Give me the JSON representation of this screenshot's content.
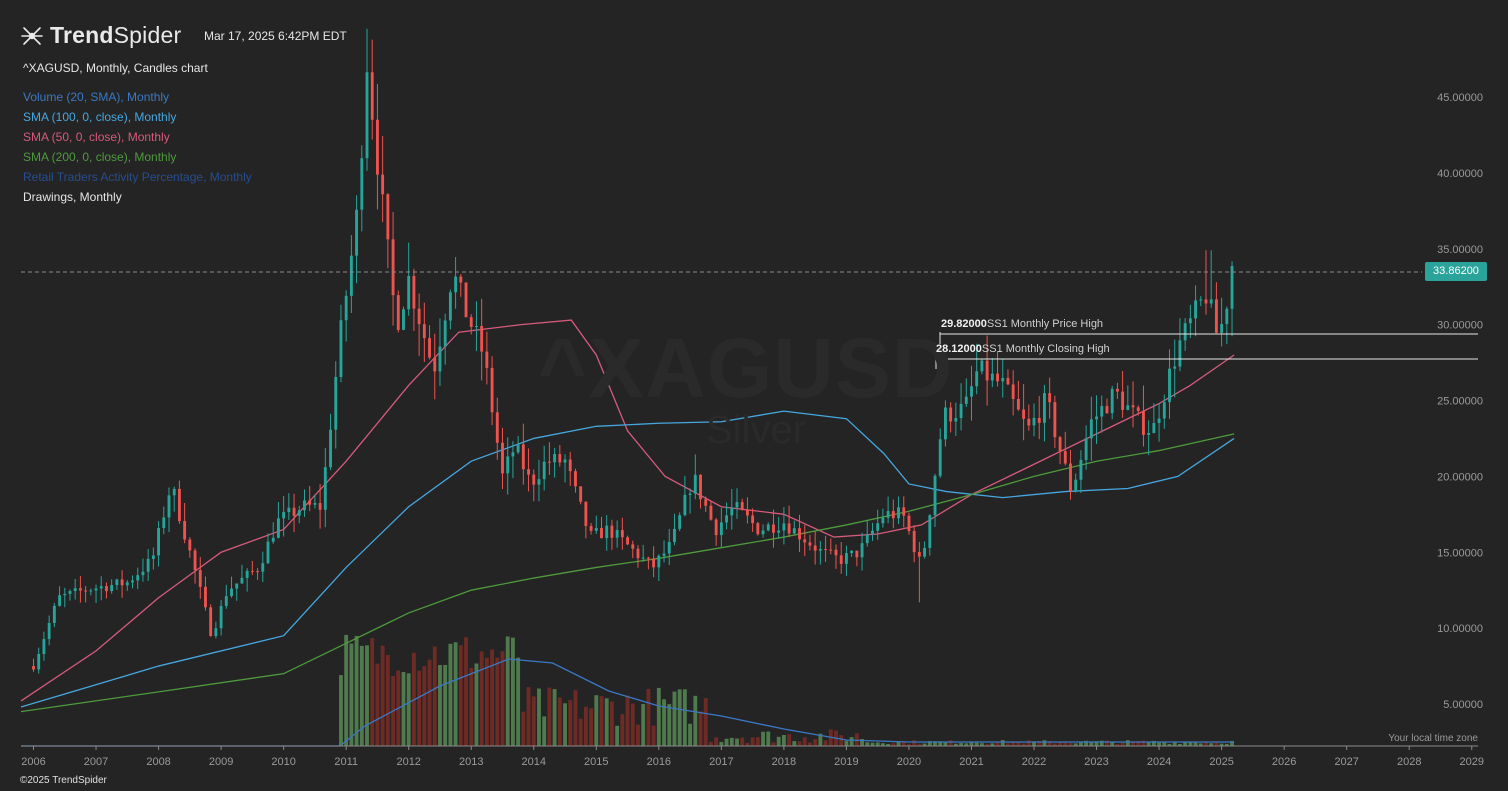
{
  "header": {
    "brand_bold": "Trend",
    "brand_light": "Spider",
    "timestamp": "Mar 17, 2025 6:42PM EDT",
    "symbol_title": "^XAGUSD, Monthly, Candles chart"
  },
  "legend": [
    {
      "label": "Volume (20, SMA), Monthly",
      "color": "#3b78c4"
    },
    {
      "label": "SMA (100, 0, close), Monthly",
      "color": "#46a6de"
    },
    {
      "label": "SMA (50, 0, close), Monthly",
      "color": "#d65a7c"
    },
    {
      "label": "SMA (200, 0, close), Monthly",
      "color": "#4e9a3c"
    },
    {
      "label": "Retail Traders Activity Percentage, Monthly",
      "color": "#274d8f"
    },
    {
      "label": "Drawings, Monthly",
      "color": "#e6e6e6"
    }
  ],
  "watermark": {
    "symbol": "^XAGUSD",
    "name": "Silver"
  },
  "current_price": "33.86200",
  "levels": [
    {
      "value": "29.82000",
      "label": "SS1 Monthly Price High"
    },
    {
      "value": "28.12000",
      "label": "SS1 Monthly Closing High"
    }
  ],
  "footer": {
    "copyright": "©2025 TrendSpider",
    "timezone_note": "Your local time zone"
  },
  "colors": {
    "up": "#26a69a",
    "down": "#ef5350",
    "vol_up": "#4f7a4d",
    "vol_down": "#6e2a25",
    "background": "#242424"
  },
  "chart_data": {
    "type": "candlestick",
    "interval": "Monthly",
    "x_range": [
      2005.8,
      2029.1
    ],
    "y_range": [
      2,
      49
    ],
    "x_ticks": [
      "2006",
      "2007",
      "2008",
      "2009",
      "2010",
      "2011",
      "2012",
      "2013",
      "2014",
      "2015",
      "2016",
      "2017",
      "2018",
      "2019",
      "2020",
      "2021",
      "2022",
      "2023",
      "2024",
      "2025",
      "2026",
      "2027",
      "2028",
      "2029"
    ],
    "y_ticks": [
      "5.00000",
      "10.00000",
      "15.00000",
      "20.00000",
      "25.00000",
      "30.00000",
      "35.00000",
      "40.00000",
      "45.00000"
    ],
    "last_close": 33.862,
    "horizontal_levels": [
      29.82,
      28.12
    ],
    "anchors": [
      {
        "t": 2006.0,
        "c": 7.5
      },
      {
        "t": 2006.4,
        "c": 12.0
      },
      {
        "t": 2006.9,
        "c": 12.6
      },
      {
        "t": 2007.5,
        "c": 13.0
      },
      {
        "t": 2007.9,
        "c": 14.5
      },
      {
        "t": 2008.2,
        "c": 19.5
      },
      {
        "t": 2008.6,
        "c": 13.5
      },
      {
        "t": 2008.85,
        "c": 9.5
      },
      {
        "t": 2009.1,
        "c": 12.5
      },
      {
        "t": 2009.6,
        "c": 14.0
      },
      {
        "t": 2009.9,
        "c": 17.0
      },
      {
        "t": 2010.3,
        "c": 18.0
      },
      {
        "t": 2010.6,
        "c": 18.0
      },
      {
        "t": 2010.9,
        "c": 29.0
      },
      {
        "t": 2011.2,
        "c": 38.0
      },
      {
        "t": 2011.32,
        "c": 48.0
      },
      {
        "t": 2011.6,
        "c": 37.0
      },
      {
        "t": 2011.8,
        "c": 30.0
      },
      {
        "t": 2012.0,
        "c": 33.0
      },
      {
        "t": 2012.4,
        "c": 27.0
      },
      {
        "t": 2012.7,
        "c": 33.5
      },
      {
        "t": 2012.9,
        "c": 31.0
      },
      {
        "t": 2013.2,
        "c": 28.0
      },
      {
        "t": 2013.5,
        "c": 20.0
      },
      {
        "t": 2013.7,
        "c": 22.0
      },
      {
        "t": 2013.95,
        "c": 19.5
      },
      {
        "t": 2014.2,
        "c": 21.0
      },
      {
        "t": 2014.5,
        "c": 21.0
      },
      {
        "t": 2014.9,
        "c": 16.0
      },
      {
        "t": 2015.2,
        "c": 16.5
      },
      {
        "t": 2015.9,
        "c": 14.0
      },
      {
        "t": 2016.2,
        "c": 15.5
      },
      {
        "t": 2016.55,
        "c": 20.0
      },
      {
        "t": 2016.9,
        "c": 16.5
      },
      {
        "t": 2017.2,
        "c": 18.0
      },
      {
        "t": 2017.6,
        "c": 16.5
      },
      {
        "t": 2018.0,
        "c": 17.0
      },
      {
        "t": 2018.6,
        "c": 15.0
      },
      {
        "t": 2018.9,
        "c": 14.5
      },
      {
        "t": 2019.2,
        "c": 15.0
      },
      {
        "t": 2019.6,
        "c": 17.5
      },
      {
        "t": 2019.9,
        "c": 17.5
      },
      {
        "t": 2020.2,
        "c": 14.0
      },
      {
        "t": 2020.55,
        "c": 24.0
      },
      {
        "t": 2020.9,
        "c": 24.5
      },
      {
        "t": 2021.1,
        "c": 27.0
      },
      {
        "t": 2021.5,
        "c": 26.0
      },
      {
        "t": 2021.9,
        "c": 23.0
      },
      {
        "t": 2022.2,
        "c": 25.0
      },
      {
        "t": 2022.6,
        "c": 19.0
      },
      {
        "t": 2022.9,
        "c": 23.5
      },
      {
        "t": 2023.3,
        "c": 25.5
      },
      {
        "t": 2023.7,
        "c": 23.5
      },
      {
        "t": 2023.9,
        "c": 23.0
      },
      {
        "t": 2024.3,
        "c": 28.5
      },
      {
        "t": 2024.75,
        "c": 32.0
      },
      {
        "t": 2024.95,
        "c": 29.0
      },
      {
        "t": 2025.2,
        "c": 33.86
      }
    ],
    "series": [
      {
        "name": "SMA (50, 0, close), Monthly",
        "color": "#d65a7c",
        "points": [
          [
            2005.8,
            5.2
          ],
          [
            2007,
            8.5
          ],
          [
            2008,
            12.0
          ],
          [
            2009,
            15.0
          ],
          [
            2010,
            16.5
          ],
          [
            2011,
            21.0
          ],
          [
            2012,
            26.0
          ],
          [
            2012.8,
            29.5
          ],
          [
            2013.8,
            30.0
          ],
          [
            2014.6,
            30.3
          ],
          [
            2015.0,
            28.0
          ],
          [
            2015.5,
            23.0
          ],
          [
            2016.1,
            20.0
          ],
          [
            2017,
            18.0
          ],
          [
            2018,
            17.5
          ],
          [
            2018.8,
            16.0
          ],
          [
            2019.5,
            16.2
          ],
          [
            2020.2,
            16.8
          ],
          [
            2021,
            18.8
          ],
          [
            2022,
            20.8
          ],
          [
            2023,
            22.8
          ],
          [
            2024,
            24.8
          ],
          [
            2024.5,
            26.0
          ],
          [
            2025.2,
            28.0
          ]
        ]
      },
      {
        "name": "SMA (100, 0, close), Monthly",
        "color": "#46a6de",
        "points": [
          [
            2005.8,
            4.8
          ],
          [
            2008,
            7.5
          ],
          [
            2010,
            9.5
          ],
          [
            2011,
            14.0
          ],
          [
            2012,
            18.0
          ],
          [
            2013,
            21.0
          ],
          [
            2014,
            22.5
          ],
          [
            2015,
            23.3
          ],
          [
            2016,
            23.5
          ],
          [
            2017,
            23.6
          ],
          [
            2018,
            24.3
          ],
          [
            2019,
            23.8
          ],
          [
            2019.6,
            21.5
          ],
          [
            2020,
            19.5
          ],
          [
            2020.6,
            19.0
          ],
          [
            2021.5,
            18.6
          ],
          [
            2022.5,
            19.0
          ],
          [
            2023.5,
            19.2
          ],
          [
            2024.3,
            20.0
          ],
          [
            2025.2,
            22.5
          ]
        ]
      },
      {
        "name": "SMA (200, 0, close), Monthly",
        "color": "#4e9a3c",
        "points": [
          [
            2005.8,
            4.5
          ],
          [
            2008,
            5.8
          ],
          [
            2010,
            7.0
          ],
          [
            2011,
            9.0
          ],
          [
            2012,
            11.0
          ],
          [
            2013,
            12.5
          ],
          [
            2014,
            13.3
          ],
          [
            2015,
            14.0
          ],
          [
            2016,
            14.6
          ],
          [
            2017,
            15.3
          ],
          [
            2018,
            16.0
          ],
          [
            2019,
            16.8
          ],
          [
            2020,
            17.7
          ],
          [
            2021,
            18.8
          ],
          [
            2022,
            20.0
          ],
          [
            2023,
            21.0
          ],
          [
            2024,
            21.7
          ],
          [
            2025.2,
            22.8
          ]
        ]
      }
    ],
    "volume_series": {
      "name": "Volume (20, SMA), Monthly",
      "color": "#3b78c4"
    }
  }
}
